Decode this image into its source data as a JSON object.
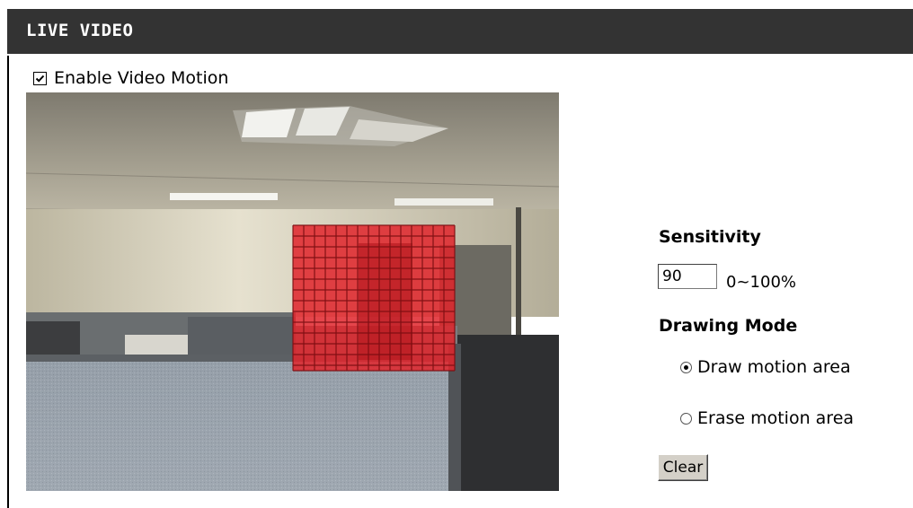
{
  "header": {
    "title": "LIVE VIDEO"
  },
  "motion": {
    "enable_label": "Enable Video Motion",
    "enabled": true
  },
  "sensitivity": {
    "heading": "Sensitivity",
    "value": "90",
    "range_label": "0~100%"
  },
  "drawing_mode": {
    "heading": "Drawing Mode",
    "options": [
      {
        "label": "Draw motion area",
        "selected": true
      },
      {
        "label": "Erase motion area",
        "selected": false
      }
    ]
  },
  "clear_label": "Clear",
  "colors": {
    "header_bg": "#333333",
    "header_text": "#ffffff",
    "motion_grid": "#e0242c"
  },
  "icons": {
    "checkbox": "checkmark-icon",
    "radio": "radio-dot-icon"
  }
}
